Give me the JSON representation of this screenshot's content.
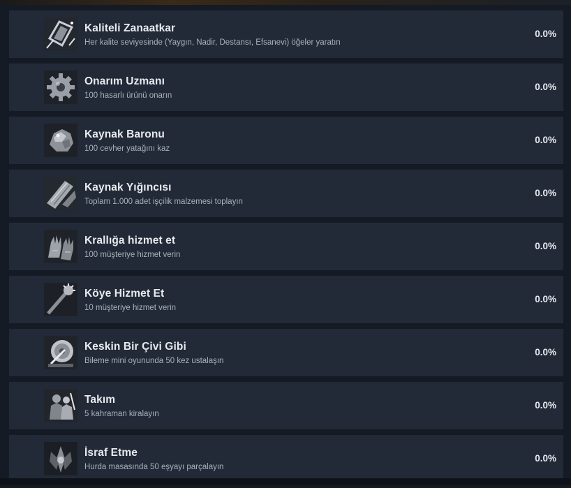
{
  "achievements": [
    {
      "title": "Kaliteli Zanaatkar",
      "description": "Her kalite seviyesinde (Yaygın, Nadir, Destansı, Efsanevi) öğeler yaratın",
      "percent": "0.0%",
      "icon": "crystal-frame-icon"
    },
    {
      "title": "Onarım Uzmanı",
      "description": "100 hasarlı ürünü onarın",
      "percent": "0.0%",
      "icon": "gear-icon"
    },
    {
      "title": "Kaynak Baronu",
      "description": "100 cevher yatağını kaz",
      "percent": "0.0%",
      "icon": "ore-icon"
    },
    {
      "title": "Kaynak Yığıncısı",
      "description": "Toplam 1.000 adet işçilik malzemesi toplayın",
      "percent": "0.0%",
      "icon": "lumber-icon"
    },
    {
      "title": "Krallığa hizmet et",
      "description": "100 müşteriye hizmet verin",
      "percent": "0.0%",
      "icon": "gloves-icon"
    },
    {
      "title": "Köye Hizmet Et",
      "description": "10 müşteriye hizmet verin",
      "percent": "0.0%",
      "icon": "mace-icon"
    },
    {
      "title": "Keskin Bir Çivi Gibi",
      "description": "Bileme mini oyununda 50 kez ustalaşın",
      "percent": "0.0%",
      "icon": "grindstone-icon"
    },
    {
      "title": "Takım",
      "description": "5 kahraman kiralayın",
      "percent": "0.0%",
      "icon": "heroes-icon"
    },
    {
      "title": "İsraf Etme",
      "description": "Hurda masasında 50 eşyayı parçalayın",
      "percent": "0.0%",
      "icon": "scrap-icon"
    }
  ]
}
